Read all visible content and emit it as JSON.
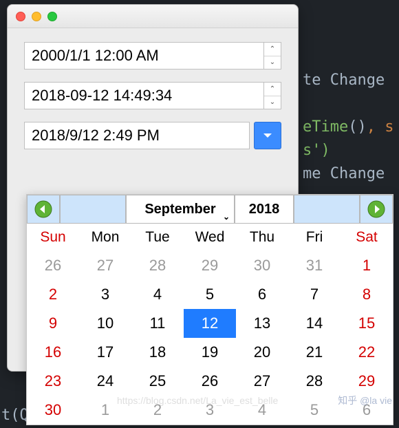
{
  "code": {
    "line1a": "te Change",
    "line2a": "eTime",
    "line2b": "()",
    "line2c": ", s",
    "line3a": "s')",
    "line4a": "me Change",
    "bottom": "t(Q"
  },
  "watermark": "https://blog.csdn.net/La_vie_est_belle",
  "zh_badge": "知乎 @la vie",
  "fields": {
    "dt1": "2000/1/1 12:00 AM",
    "dt2": "2018-09-12 14:49:34",
    "dt3": "2018/9/12 2:49 PM"
  },
  "calendar": {
    "month": "September",
    "year": "2018",
    "dow": [
      "Sun",
      "Mon",
      "Tue",
      "Wed",
      "Thu",
      "Fri",
      "Sat"
    ],
    "days": [
      {
        "n": "26",
        "o": true,
        "w": true
      },
      {
        "n": "27",
        "o": true
      },
      {
        "n": "28",
        "o": true
      },
      {
        "n": "29",
        "o": true
      },
      {
        "n": "30",
        "o": true
      },
      {
        "n": "31",
        "o": true
      },
      {
        "n": "1",
        "w": true
      },
      {
        "n": "2",
        "w": true
      },
      {
        "n": "3"
      },
      {
        "n": "4"
      },
      {
        "n": "5"
      },
      {
        "n": "6"
      },
      {
        "n": "7"
      },
      {
        "n": "8",
        "w": true
      },
      {
        "n": "9",
        "w": true
      },
      {
        "n": "10"
      },
      {
        "n": "11"
      },
      {
        "n": "12",
        "sel": true
      },
      {
        "n": "13"
      },
      {
        "n": "14"
      },
      {
        "n": "15",
        "w": true
      },
      {
        "n": "16",
        "w": true
      },
      {
        "n": "17"
      },
      {
        "n": "18"
      },
      {
        "n": "19"
      },
      {
        "n": "20"
      },
      {
        "n": "21"
      },
      {
        "n": "22",
        "w": true
      },
      {
        "n": "23",
        "w": true
      },
      {
        "n": "24"
      },
      {
        "n": "25"
      },
      {
        "n": "26"
      },
      {
        "n": "27"
      },
      {
        "n": "28"
      },
      {
        "n": "29",
        "w": true
      },
      {
        "n": "30",
        "w": true
      },
      {
        "n": "1",
        "o": true
      },
      {
        "n": "2",
        "o": true
      },
      {
        "n": "3",
        "o": true
      },
      {
        "n": "4",
        "o": true
      },
      {
        "n": "5",
        "o": true
      },
      {
        "n": "6",
        "o": true,
        "w": true
      }
    ]
  }
}
